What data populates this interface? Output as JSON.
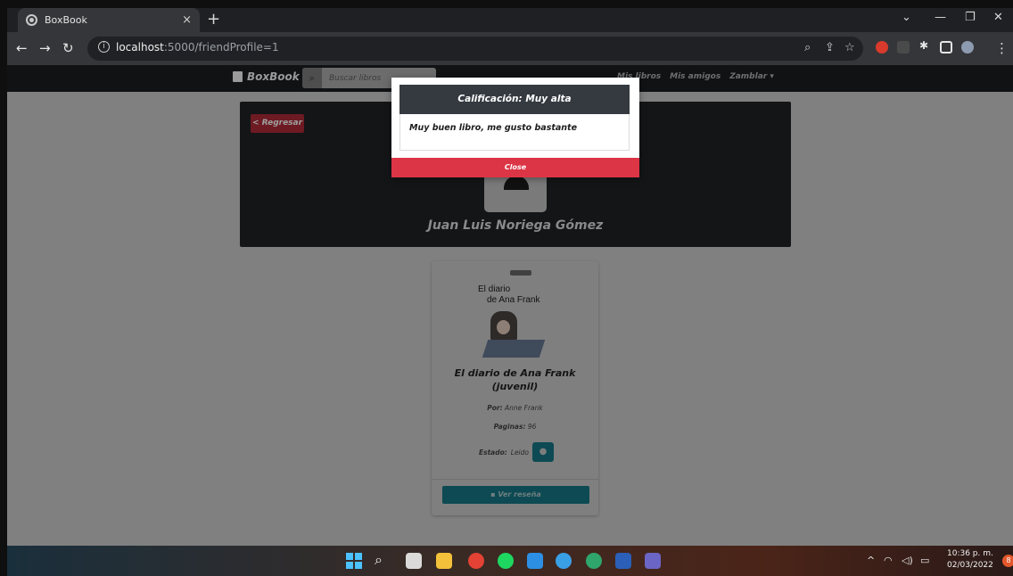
{
  "browser": {
    "tab_title": "BoxBook",
    "tab_close": "×",
    "new_tab": "+",
    "url_host": "localhost",
    "url_rest": ":5000/friendProfile=1"
  },
  "navbar": {
    "brand": "BoxBook",
    "search_placeholder": "Buscar libros",
    "links": [
      "Mis libros",
      "Mis amigos",
      "Zamblar"
    ]
  },
  "profile": {
    "back_label": "< Regresar",
    "name": "Juan Luis Noriega Gómez"
  },
  "book": {
    "cover_title_1": "El diario",
    "cover_title_2": "de Ana Frank",
    "title": "El diario de Ana Frank (juvenil)",
    "author_label": "Por:",
    "author": "Anne Frank",
    "pages_label": "Paginas:",
    "pages": "96",
    "state_label": "Estado:",
    "state": "Leido",
    "review_button": "Ver reseña"
  },
  "modal": {
    "header": "Calificación: Muy alta",
    "body": "Muy buen libro, me gusto bastante",
    "close": "Close"
  },
  "taskbar": {
    "time": "10:36 p. m.",
    "date": "02/03/2022",
    "notifications": "8"
  },
  "colors": {
    "modal_header": "#343a40",
    "close_button": "#dc3545",
    "teal_button": "#17a2b8",
    "back_button": "#dc3545"
  }
}
